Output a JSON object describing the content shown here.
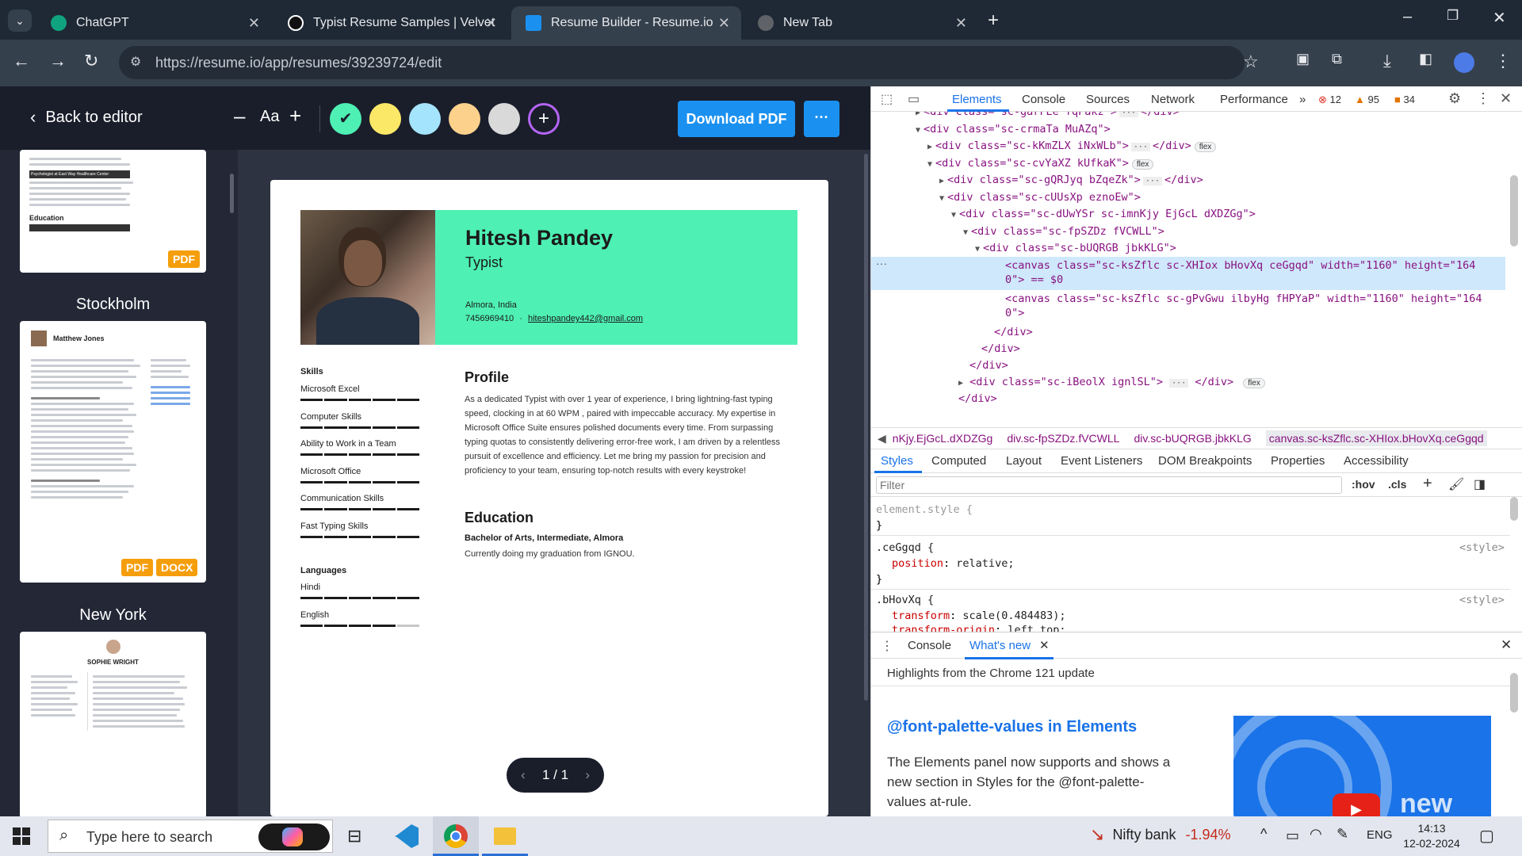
{
  "browser": {
    "tabs": [
      {
        "title": "ChatGPT"
      },
      {
        "title": "Typist Resume Samples | Velvet"
      },
      {
        "title": "Resume Builder - Resume.io"
      },
      {
        "title": "New Tab"
      }
    ],
    "url": "https://resume.io/app/resumes/39239724/edit"
  },
  "app": {
    "back_label": "Back to editor",
    "font_label": "Aa",
    "download_label": "Download PDF",
    "more_label": "···",
    "colors": [
      "#4ef0b4",
      "#fbe866",
      "#a5e4fd",
      "#fcd18c",
      "#d9d9d9"
    ],
    "templates": [
      {
        "name": "",
        "badges": [
          "PDF"
        ]
      },
      {
        "name": "Stockholm",
        "badges": [
          "PDF",
          "DOCX"
        ]
      },
      {
        "name": "New York",
        "badges": []
      }
    ],
    "thumb1": {
      "section": "Education",
      "line1": "Psychologist at East Way Healthcare Center"
    },
    "thumb2": {
      "name": "Matthew Jones"
    },
    "thumb3": {
      "name": "SOPHIE WRIGHT"
    },
    "pagination": "1 / 1"
  },
  "resume": {
    "name": "Hitesh Pandey",
    "title": "Typist",
    "location": "Almora, India",
    "phone": "7456969410",
    "email": "hiteshpandey442@gmail.com",
    "skills_heading": "Skills",
    "skills": [
      {
        "name": "Microsoft Excel",
        "level": 5
      },
      {
        "name": "Computer Skills",
        "level": 5
      },
      {
        "name": "Ability to Work in a Team",
        "level": 5
      },
      {
        "name": "Microsoft Office",
        "level": 5
      },
      {
        "name": "Communication Skills",
        "level": 5
      },
      {
        "name": "Fast Typing Skills",
        "level": 5
      }
    ],
    "languages_heading": "Languages",
    "languages": [
      {
        "name": "Hindi",
        "level": 5
      },
      {
        "name": "English",
        "level": 4
      }
    ],
    "profile_heading": "Profile",
    "profile_text": "As a dedicated Typist with over 1 year of experience, I bring lightning-fast typing speed, clocking in at 60 WPM , paired with impeccable accuracy. My expertise in Microsoft Office Suite ensures polished documents every time. From surpassing typing quotas to consistently delivering error-free work, I am driven by a relentless pursuit of excellence and efficiency. Let me bring my passion for precision and proficiency to your team, ensuring top-notch results with every keystroke!",
    "education_heading": "Education",
    "education_degree": "Bachelor of Arts, Intermediate, Almora",
    "education_note": "Currently doing my graduation from IGNOU.",
    "accent": "#4ef0b4"
  },
  "devtools": {
    "tabs": [
      "Elements",
      "Console",
      "Sources",
      "Network",
      "Performance"
    ],
    "errors": "12",
    "warnings": "95",
    "issues": "34",
    "dom_lines": [
      {
        "indent": 4,
        "arrow": "▶",
        "text": "<div class=\"sc-garFEe fqPakz\">",
        "tail": "</div>",
        "ellipsis": true,
        "pill": ""
      },
      {
        "indent": 4,
        "arrow": "▼",
        "text": "<div class=\"sc-crmaTa MuAZq\">",
        "tail": "",
        "ellipsis": false,
        "pill": ""
      },
      {
        "indent": 5,
        "arrow": "▶",
        "text": "<div class=\"sc-kKmZLX iNxWLb\">",
        "tail": "</div>",
        "ellipsis": true,
        "pill": "flex"
      },
      {
        "indent": 5,
        "arrow": "▼",
        "text": "<div class=\"sc-cvYaXZ kUfkaK\">",
        "tail": "",
        "ellipsis": false,
        "pill": "flex"
      },
      {
        "indent": 6,
        "arrow": "▶",
        "text": "<div class=\"sc-gQRJyq bZqeZk\">",
        "tail": "</div>",
        "ellipsis": true,
        "pill": ""
      },
      {
        "indent": 6,
        "arrow": "▼",
        "text": "<div class=\"sc-cUUsXp eznoEw\">",
        "tail": "",
        "ellipsis": false,
        "pill": ""
      },
      {
        "indent": 7,
        "arrow": "▼",
        "text": "<div class=\"sc-dUwYSr sc-imnKjy EjGcL dXDZGg\">",
        "tail": "",
        "ellipsis": false,
        "pill": ""
      },
      {
        "indent": 8,
        "arrow": "▼",
        "text": "<div class=\"sc-fpSZDz fVCWLL\">",
        "tail": "",
        "ellipsis": false,
        "pill": ""
      },
      {
        "indent": 9,
        "arrow": "▼",
        "text": "<div class=\"sc-bUQRGB jbkKLG\">",
        "tail": "",
        "ellipsis": false,
        "pill": ""
      }
    ],
    "canvas1": "<canvas class=\"sc-ksZflc sc-XHIox bHovXq ceGgqd\" width=\"1160\" height=\"164",
    "canvas1b": "0\"> == $0",
    "canvas2": "<canvas class=\"sc-ksZflc sc-gPvGwu ilbyHg fHPYaP\" width=\"1160\" height=\"164",
    "canvas2b": "0\">",
    "close_lines": [
      "</div>",
      "</div>",
      "</div>"
    ],
    "last_div": "<div class=\"sc-iBeolX ignlSL\">",
    "last_div_tail": "</div>",
    "last_close": "</div>",
    "breadcrumbs": [
      "nKjy.EjGcL.dXDZGg",
      "div.sc-fpSZDz.fVCWLL",
      "div.sc-bUQRGB.jbkKLG",
      "canvas.sc-ksZflc.sc-XHIox.bHovXq.ceGgqd"
    ],
    "style_tabs": [
      "Styles",
      "Computed",
      "Layout",
      "Event Listeners",
      "DOM Breakpoints",
      "Properties",
      "Accessibility"
    ],
    "filter_placeholder": "Filter",
    "hov": ":hov",
    "cls": ".cls",
    "element_style": "element.style {",
    "rule1_sel": ".ceGgqd {",
    "rule1_prop": "position",
    "rule1_val": "relative;",
    "rule2_sel": ".bHovXq {",
    "rule2_prop": "transform",
    "rule2_val": "scale(0.484483);",
    "rule3_prop": "transform-origin",
    "rule3_val": "left top;",
    "style_src": "<style>",
    "drawer_tabs": [
      "Console",
      "What's new"
    ],
    "highlights": "Highlights from the Chrome 121 update",
    "wn_title": "@font-palette-values in Elements",
    "wn_text": "The Elements panel now supports and shows a new section in Styles for the @font-palette-values at-rule.",
    "video_text": "new"
  },
  "taskbar": {
    "search_placeholder": "Type here to search",
    "stock_name": "Nifty bank",
    "stock_change": "-1.94%",
    "lang": "ENG",
    "time": "14:13",
    "date": "12-02-2024"
  }
}
